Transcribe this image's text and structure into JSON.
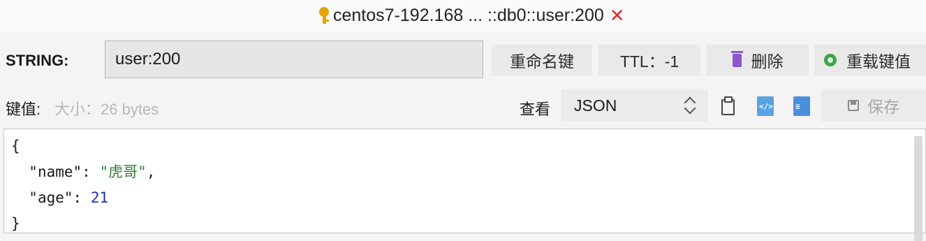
{
  "tab": {
    "icon": "key-icon",
    "title": "centos7-192.168 ... ::db0::user:200",
    "close_symbol": "✕",
    "close_color": "#e02b2b"
  },
  "toolbar": {
    "type_label": "STRING:",
    "key_value": "user:200",
    "rename_label": "重命名键",
    "ttl_label": "TTL：-1",
    "delete_label": "删除",
    "delete_icon": "trash-icon",
    "reload_label": "重载键值",
    "reload_icon": "reload-icon"
  },
  "value_bar": {
    "value_label": "键值:",
    "size_info": "大小：26 bytes",
    "view_label": "查看",
    "format_selected": "JSON",
    "icons": [
      "copy-icon",
      "html-file-icon",
      "text-file-icon"
    ],
    "save_label": "保存",
    "save_icon": "save-icon"
  },
  "editor": {
    "lines": {
      "open": "{",
      "name_key": "\"name\"",
      "name_value": "\"虎哥\"",
      "age_key": "\"age\"",
      "age_value": "21",
      "close": "}"
    }
  },
  "colors": {
    "string_value": "#2e7d32",
    "number_value": "#1a33a8",
    "delete_icon": "#8b58c9",
    "reload_icon": "#3aa646",
    "key_icon": "#e5a300"
  }
}
